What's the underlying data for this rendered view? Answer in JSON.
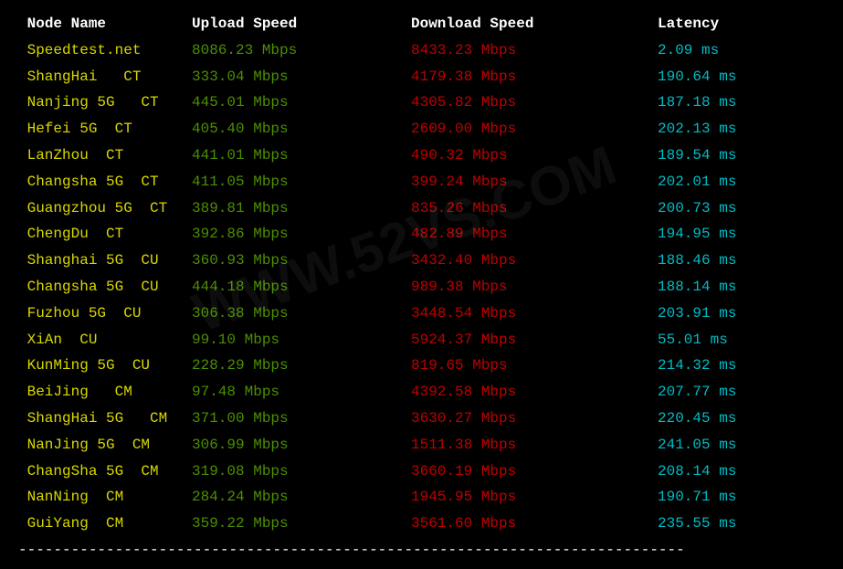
{
  "headers": {
    "node": "Node Name",
    "upload": "Upload Speed",
    "download": "Download Speed",
    "latency": "Latency"
  },
  "divider_line": "----------------------------------------------------------------------------",
  "watermark": "WWW.52VS.COM",
  "rows": [
    {
      "node": "Speedtest.net",
      "upload": "8086.23 Mbps",
      "download": "8433.23 Mbps",
      "latency": "2.09 ms"
    },
    {
      "node": "ShangHai   CT",
      "upload": "333.04 Mbps",
      "download": "4179.38 Mbps",
      "latency": "190.64 ms"
    },
    {
      "node": "Nanjing 5G   CT",
      "upload": "445.01 Mbps",
      "download": "4305.82 Mbps",
      "latency": "187.18 ms"
    },
    {
      "node": "Hefei 5G  CT",
      "upload": "405.40 Mbps",
      "download": "2609.00 Mbps",
      "latency": "202.13 ms"
    },
    {
      "node": "LanZhou  CT",
      "upload": "441.01 Mbps",
      "download": "490.32 Mbps",
      "latency": "189.54 ms"
    },
    {
      "node": "Changsha 5G  CT",
      "upload": "411.05 Mbps",
      "download": "399.24 Mbps",
      "latency": "202.01 ms"
    },
    {
      "node": "Guangzhou 5G  CT",
      "upload": "389.81 Mbps",
      "download": "835.26 Mbps",
      "latency": "200.73 ms"
    },
    {
      "node": "ChengDu  CT",
      "upload": "392.86 Mbps",
      "download": "482.89 Mbps",
      "latency": "194.95 ms"
    },
    {
      "node": "Shanghai 5G  CU",
      "upload": "360.93 Mbps",
      "download": "3432.40 Mbps",
      "latency": "188.46 ms"
    },
    {
      "node": "Changsha 5G  CU",
      "upload": "444.18 Mbps",
      "download": "989.38 Mbps",
      "latency": "188.14 ms"
    },
    {
      "node": "Fuzhou 5G  CU",
      "upload": "306.38 Mbps",
      "download": "3448.54 Mbps",
      "latency": "203.91 ms"
    },
    {
      "node": "XiAn  CU",
      "upload": "99.10 Mbps",
      "download": "5924.37 Mbps",
      "latency": "55.01 ms"
    },
    {
      "node": "KunMing 5G  CU",
      "upload": "228.29 Mbps",
      "download": "819.65 Mbps",
      "latency": "214.32 ms"
    },
    {
      "node": "BeiJing   CM",
      "upload": "97.48 Mbps",
      "download": "4392.58 Mbps",
      "latency": "207.77 ms"
    },
    {
      "node": "ShangHai 5G   CM",
      "upload": "371.00 Mbps",
      "download": "3630.27 Mbps",
      "latency": "220.45 ms"
    },
    {
      "node": "NanJing 5G  CM",
      "upload": "306.99 Mbps",
      "download": "1511.38 Mbps",
      "latency": "241.05 ms"
    },
    {
      "node": "ChangSha 5G  CM",
      "upload": "319.08 Mbps",
      "download": "3660.19 Mbps",
      "latency": "208.14 ms"
    },
    {
      "node": "NanNing  CM",
      "upload": "284.24 Mbps",
      "download": "1945.95 Mbps",
      "latency": "190.71 ms"
    },
    {
      "node": "GuiYang  CM",
      "upload": "359.22 Mbps",
      "download": "3561.60 Mbps",
      "latency": "235.55 ms"
    }
  ],
  "chart_data": {
    "type": "table",
    "title": "Network Speed Test Results",
    "columns": [
      "Node Name",
      "Upload Speed (Mbps)",
      "Download Speed (Mbps)",
      "Latency (ms)"
    ],
    "data": [
      [
        "Speedtest.net",
        8086.23,
        8433.23,
        2.09
      ],
      [
        "ShangHai CT",
        333.04,
        4179.38,
        190.64
      ],
      [
        "Nanjing 5G CT",
        445.01,
        4305.82,
        187.18
      ],
      [
        "Hefei 5G CT",
        405.4,
        2609.0,
        202.13
      ],
      [
        "LanZhou CT",
        441.01,
        490.32,
        189.54
      ],
      [
        "Changsha 5G CT",
        411.05,
        399.24,
        202.01
      ],
      [
        "Guangzhou 5G CT",
        389.81,
        835.26,
        200.73
      ],
      [
        "ChengDu CT",
        392.86,
        482.89,
        194.95
      ],
      [
        "Shanghai 5G CU",
        360.93,
        3432.4,
        188.46
      ],
      [
        "Changsha 5G CU",
        444.18,
        989.38,
        188.14
      ],
      [
        "Fuzhou 5G CU",
        306.38,
        3448.54,
        203.91
      ],
      [
        "XiAn CU",
        99.1,
        5924.37,
        55.01
      ],
      [
        "KunMing 5G CU",
        228.29,
        819.65,
        214.32
      ],
      [
        "BeiJing CM",
        97.48,
        4392.58,
        207.77
      ],
      [
        "ShangHai 5G CM",
        371.0,
        3630.27,
        220.45
      ],
      [
        "NanJing 5G CM",
        306.99,
        1511.38,
        241.05
      ],
      [
        "ChangSha 5G CM",
        319.08,
        3660.19,
        208.14
      ],
      [
        "NanNing CM",
        284.24,
        1945.95,
        190.71
      ],
      [
        "GuiYang CM",
        359.22,
        3561.6,
        235.55
      ]
    ]
  }
}
